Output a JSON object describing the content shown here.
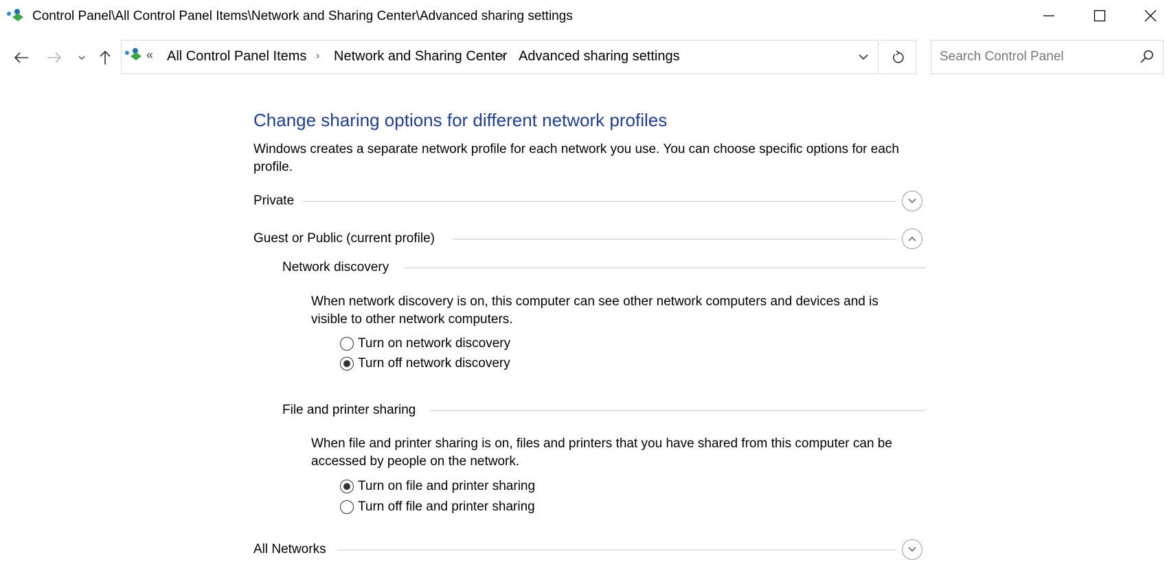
{
  "window": {
    "title": "Control Panel\\All Control Panel Items\\Network and Sharing Center\\Advanced sharing settings",
    "buttons": [
      "minimize-icon",
      "maximize-icon",
      "close-icon"
    ]
  },
  "nav": {
    "overflow": "«",
    "breadcrumbs": [
      "All Control Panel Items",
      "Network and Sharing Center",
      "Advanced sharing settings"
    ],
    "separator": "›"
  },
  "search": {
    "placeholder": "Search Control Panel",
    "value": ""
  },
  "main": {
    "title": "Change sharing options for different network profiles",
    "description": "Windows creates a separate network profile for each network you use. You can choose specific options for each profile.",
    "profiles": {
      "private": {
        "label": "Private",
        "expanded": false
      },
      "guest": {
        "label": "Guest or Public (current profile)",
        "expanded": true
      },
      "all": {
        "label": "All Networks",
        "expanded": false
      }
    },
    "network_discovery": {
      "heading": "Network discovery",
      "description": "When network discovery is on, this computer can see other network computers and devices and is visible to other network computers.",
      "options": [
        {
          "label": "Turn on network discovery",
          "selected": false
        },
        {
          "label": "Turn off network discovery",
          "selected": true
        }
      ]
    },
    "file_sharing": {
      "heading": "File and printer sharing",
      "description": "When file and printer sharing is on, files and printers that you have shared from this computer can be accessed by people on the network.",
      "options": [
        {
          "label": "Turn on file and printer sharing",
          "selected": true
        },
        {
          "label": "Turn off file and printer sharing",
          "selected": false
        }
      ]
    }
  },
  "colors": {
    "heading_blue": "#1e3e98",
    "line": "#c8c8c8"
  }
}
